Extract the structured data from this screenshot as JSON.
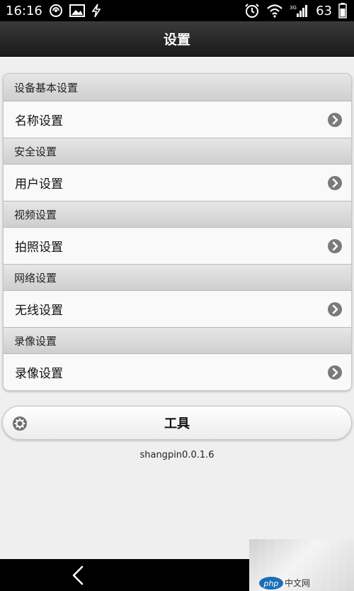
{
  "status_bar": {
    "time": "16:16",
    "battery": "63",
    "network": "3G"
  },
  "header": {
    "title": "设置"
  },
  "settings": {
    "groups": [
      {
        "header": "设备基本设置",
        "item": "名称设置"
      },
      {
        "header": "安全设置",
        "item": "用户设置"
      },
      {
        "header": "视频设置",
        "item": "拍照设置"
      },
      {
        "header": "网络设置",
        "item": "无线设置"
      },
      {
        "header": "录像设置",
        "item": "录像设置"
      }
    ]
  },
  "tools": {
    "label": "工具"
  },
  "version": "shangpin0.0.1.6",
  "watermark": {
    "logo": "php",
    "text": "中文网"
  },
  "icons": {
    "arrow": "chevron-right-circle-icon",
    "gear": "gear-icon",
    "back": "back-icon"
  },
  "colors": {
    "status_bar": "#000000",
    "header": "#2a2a2a",
    "background": "#efefef",
    "arrow": "#777777"
  }
}
